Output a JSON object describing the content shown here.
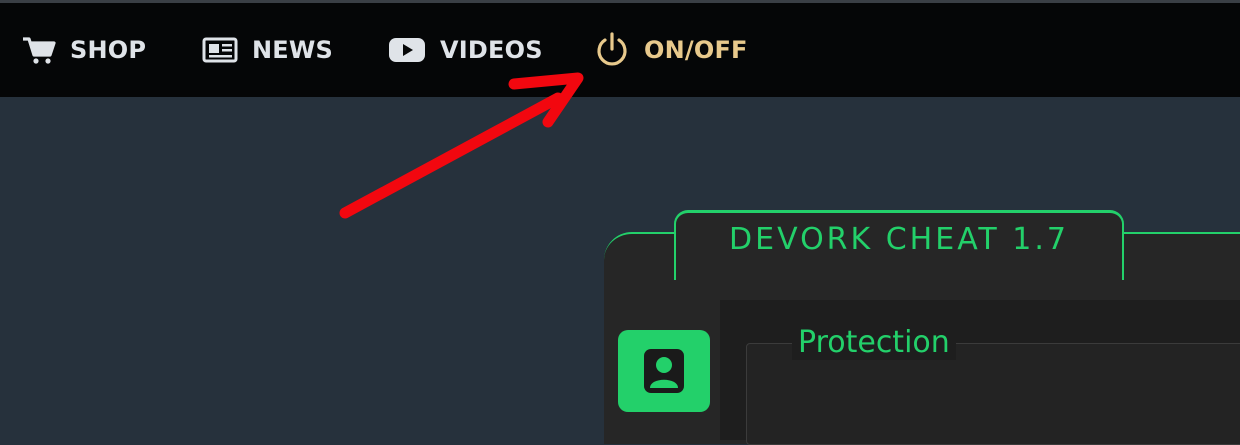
{
  "navbar": {
    "items": [
      {
        "label": "SHOP",
        "icon": "cart-icon"
      },
      {
        "label": "NEWS",
        "icon": "newspaper-icon"
      },
      {
        "label": "VIDEOS",
        "icon": "youtube-icon"
      },
      {
        "label": "ON/OFF",
        "icon": "power-icon"
      }
    ]
  },
  "window": {
    "title": "DEVORK CHEAT 1.7",
    "group_label": "Protection",
    "sidebar_button_icon": "user-icon"
  },
  "colors": {
    "accent_green": "#23d06a",
    "active_nav": "#e8c98c",
    "annotation_arrow": "#f2070f"
  }
}
